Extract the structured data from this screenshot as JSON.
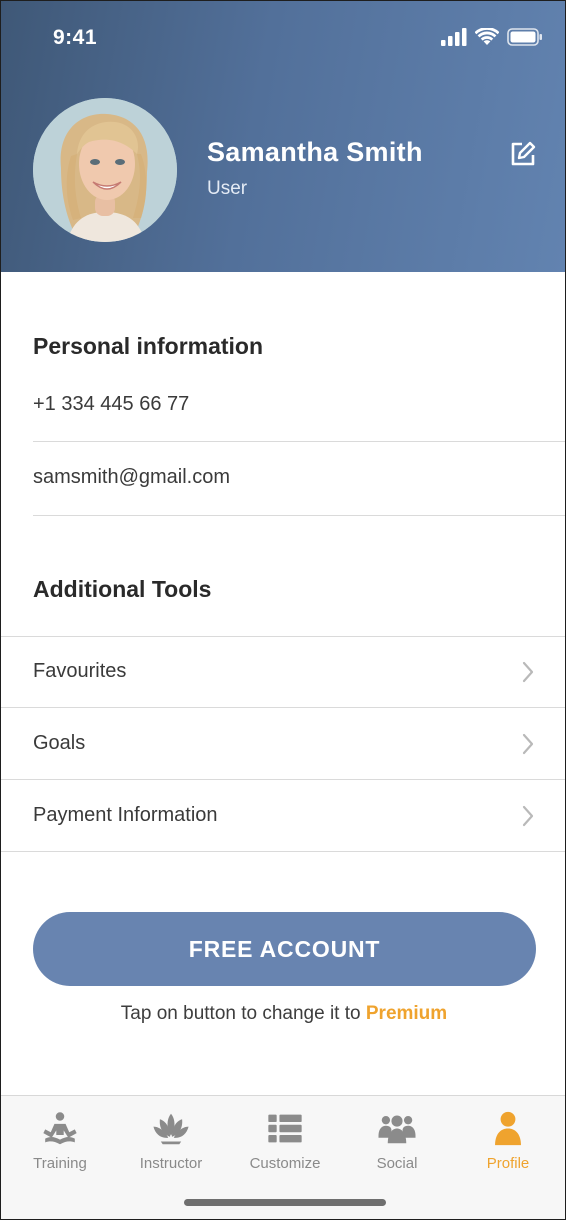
{
  "status_bar": {
    "time": "9:41"
  },
  "profile": {
    "name": "Samantha Smith",
    "role": "User",
    "edit_icon": "edit-icon"
  },
  "personal_info": {
    "title": "Personal information",
    "phone": "+1 334 445 66 77",
    "email": "samsmith@gmail.com"
  },
  "additional_tools": {
    "title": "Additional Tools",
    "items": [
      {
        "label": "Favourites",
        "icon": "chevron-right-icon"
      },
      {
        "label": "Goals",
        "icon": "chevron-right-icon"
      },
      {
        "label": "Payment Information",
        "icon": "chevron-right-icon"
      }
    ]
  },
  "account": {
    "button_label": "FREE ACCOUNT",
    "hint_prefix": "Tap on button to change it to ",
    "hint_highlight": "Premium"
  },
  "tabs": [
    {
      "label": "Training",
      "icon": "meditation-icon",
      "active": false
    },
    {
      "label": "Instructor",
      "icon": "lotus-icon",
      "active": false
    },
    {
      "label": "Customize",
      "icon": "list-icon",
      "active": false
    },
    {
      "label": "Social",
      "icon": "group-icon",
      "active": false
    },
    {
      "label": "Profile",
      "icon": "person-icon",
      "active": true
    }
  ],
  "colors": {
    "header_gradient_start": "#3f5877",
    "header_gradient_end": "#6283b0",
    "button": "#6884b0",
    "accent": "#efa32e",
    "tab_inactive": "#8a8a8a"
  }
}
